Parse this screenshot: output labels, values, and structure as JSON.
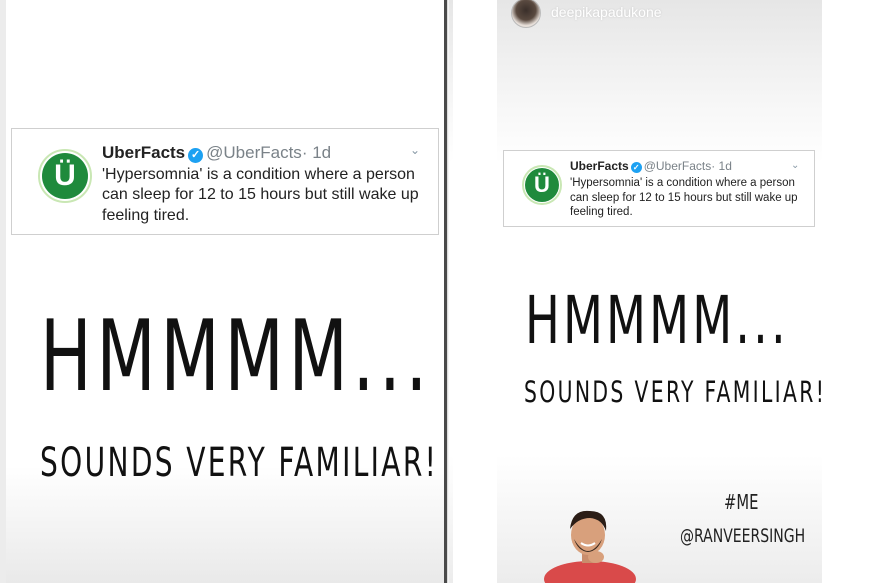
{
  "left_story": {
    "tweet": {
      "account_name": "UberFacts",
      "handle": "@UberFacts",
      "time": "· 1d",
      "avatar_letter": "Ü",
      "verified_glyph": "✓",
      "menu_icon": "chevron-down-icon",
      "text": "'Hypersomnia' is a condition where a person can sleep for 12 to 15 hours but still wake up feeling tired."
    },
    "headline": "HMMMM...",
    "subheadline": "SOUNDS VERY FAMILIAR!"
  },
  "right_story": {
    "username": "deepikapadukone",
    "tweet": {
      "account_name": "UberFacts",
      "handle": "@UberFacts",
      "time": "· 1d",
      "avatar_letter": "Ü",
      "verified_glyph": "✓",
      "menu_icon": "chevron-down-icon",
      "text": "'Hypersomnia' is a condition where a person can sleep for 12 to 15 hours but still wake up feeling tired."
    },
    "headline": "HMMMM...",
    "subheadline": "SOUNDS VERY FAMILIAR!",
    "hashtag": "#ME",
    "mention": "@RANVEERSINGH"
  },
  "colors": {
    "uberfacts_green": "#1f8a3c",
    "verified_blue": "#1da1f2",
    "text_dark": "#111111",
    "handle_gray": "#7a8288"
  }
}
